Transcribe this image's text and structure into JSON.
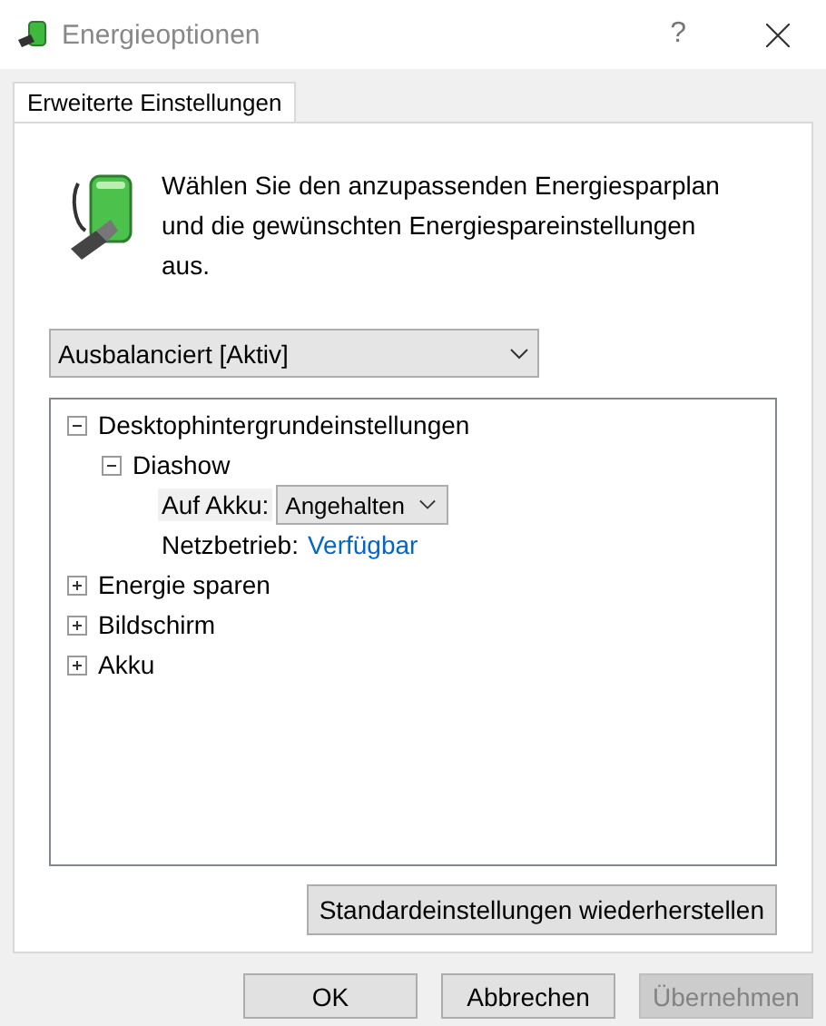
{
  "window": {
    "title": "Energieoptionen",
    "help": "?"
  },
  "tabs": [
    {
      "label": "Erweiterte Einstellungen",
      "selected": true
    }
  ],
  "intro": "Wählen Sie den anzupassenden Energiesparplan und die gewünschten Energiespareinstellungen aus.",
  "plan_dropdown": {
    "value": "Ausbalanciert [Aktiv]"
  },
  "tree": [
    {
      "label": "Desktophintergrundeinstellungen",
      "expanded": true,
      "children": [
        {
          "label": "Diashow",
          "expanded": true,
          "children": [
            {
              "kind": "dropdown",
              "label": "Auf Akku:",
              "value": "Angehalten",
              "selected": true
            },
            {
              "kind": "link",
              "label": "Netzbetrieb:",
              "value": "Verfügbar",
              "selected": false
            }
          ]
        }
      ]
    },
    {
      "label": "Energie sparen",
      "expanded": false
    },
    {
      "label": "Bildschirm",
      "expanded": false
    },
    {
      "label": "Akku",
      "expanded": false
    }
  ],
  "restore_button": "Standardeinstellungen wiederherstellen",
  "buttons": [
    {
      "label": "OK",
      "disabled": false
    },
    {
      "label": "Abbrechen",
      "disabled": false
    },
    {
      "label": "Übernehmen",
      "disabled": true
    }
  ]
}
